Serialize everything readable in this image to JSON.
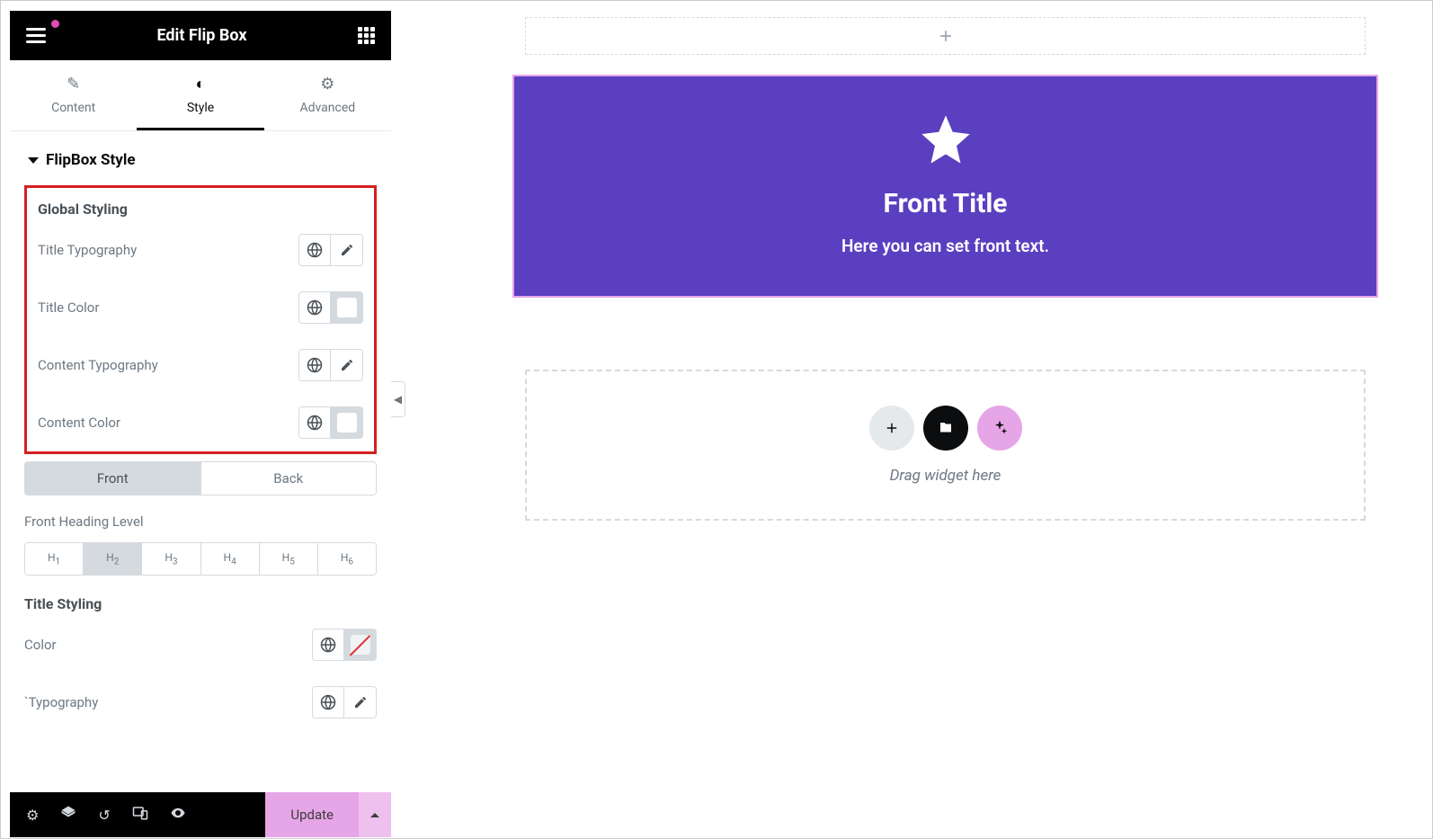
{
  "header": {
    "title": "Edit Flip Box"
  },
  "tabs": [
    {
      "label": "Content",
      "active": false
    },
    {
      "label": "Style",
      "active": true
    },
    {
      "label": "Advanced",
      "active": false
    }
  ],
  "section": {
    "title": "FlipBox Style"
  },
  "global_styling": {
    "heading": "Global Styling",
    "rows": [
      {
        "label": "Title Typography",
        "type": "typo"
      },
      {
        "label": "Title Color",
        "type": "color"
      },
      {
        "label": "Content Typography",
        "type": "typo"
      },
      {
        "label": "Content Color",
        "type": "color"
      }
    ]
  },
  "front_back": {
    "front": "Front",
    "back": "Back",
    "active": "Front"
  },
  "front_heading": {
    "label": "Front Heading Level",
    "levels": [
      "H1",
      "H2",
      "H3",
      "H4",
      "H5",
      "H6"
    ],
    "active": "H2"
  },
  "title_styling": {
    "heading": "Title Styling",
    "rows": [
      {
        "label": "Color",
        "type": "color-strike"
      },
      {
        "label": "`Typography",
        "type": "typo"
      }
    ]
  },
  "bottom": {
    "update": "Update"
  },
  "canvas": {
    "flipbox_title": "Front Title",
    "flipbox_text": "Here you can set front text.",
    "drop_text": "Drag widget here"
  }
}
